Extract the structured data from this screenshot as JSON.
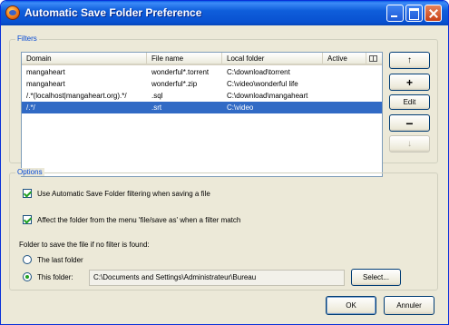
{
  "window": {
    "title": "Automatic Save Folder Preference"
  },
  "filters": {
    "group_label": "Filters",
    "columns": {
      "domain": "Domain",
      "file_name": "File name",
      "local_folder": "Local folder",
      "active": "Active"
    },
    "rows": [
      {
        "domain": "mangaheart",
        "file_name": "wonderful*.torrent",
        "local_folder": "C:\\download\\torrent",
        "active": true,
        "selected": false
      },
      {
        "domain": "mangaheart",
        "file_name": "wonderful*.zip",
        "local_folder": "C:\\video\\wonderful life",
        "active": true,
        "selected": false
      },
      {
        "domain": "/.*(localhost|mangaheart.org).*/",
        "file_name": ".sql",
        "local_folder": "C:\\download\\mangaheart",
        "active": true,
        "selected": false
      },
      {
        "domain": "/.*/",
        "file_name": ".srt",
        "local_folder": "C:\\video",
        "active": true,
        "selected": true
      }
    ],
    "buttons": {
      "move_up": "↑",
      "add": "+",
      "edit": "Edit",
      "remove": "−",
      "move_down": "↓"
    }
  },
  "options": {
    "group_label": "Options",
    "use_filtering": {
      "label": "Use Automatic Save Folder filtering when saving a file",
      "checked": true
    },
    "affect_folder": {
      "label": "Affect the folder from the menu 'file/save as' when a filter match",
      "checked": true
    },
    "no_filter_heading": "Folder to save the file if no filter is found:",
    "last_folder": {
      "label": "The last folder",
      "checked": false
    },
    "this_folder": {
      "label": "This folder:",
      "checked": true
    },
    "folder_path": "C:\\Documents and Settings\\Administrateur\\Bureau",
    "select_label": "Select..."
  },
  "dialog_buttons": {
    "ok": "OK",
    "cancel": "Annuler"
  },
  "icons": {
    "app": "firefox-icon",
    "minimize": "minimize-icon",
    "maximize": "maximize-icon",
    "close": "close-icon",
    "columns": "column-picker-icon",
    "active": "active-diamond-icon",
    "up": "arrow-up-icon",
    "down": "arrow-down-icon",
    "add": "plus-icon",
    "remove": "minus-icon"
  },
  "colors": {
    "titlebar": "#0851d0",
    "selection": "#316ac5",
    "group_label": "#0046d5",
    "active_dot": "#3d9b1a"
  }
}
